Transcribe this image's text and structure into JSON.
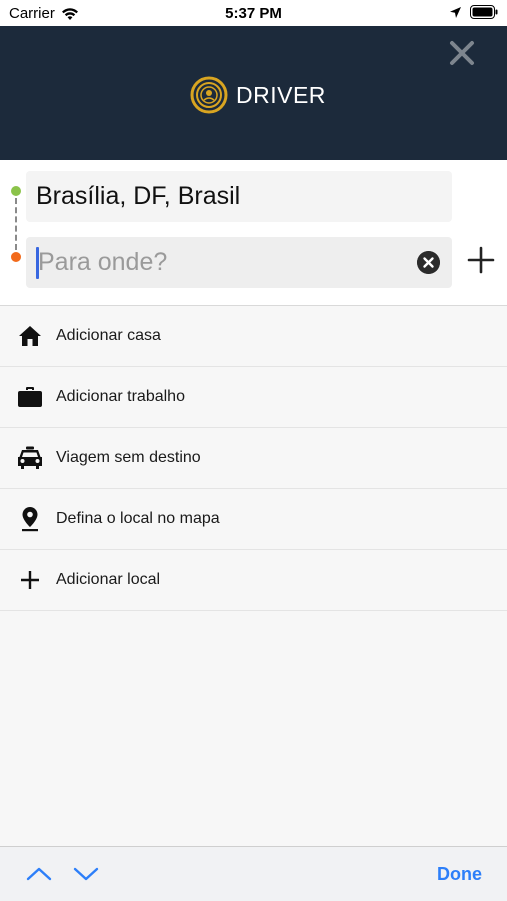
{
  "status_bar": {
    "carrier": "Carrier",
    "time": "5:37 PM",
    "icons": [
      "wifi-icon",
      "location-arrow-icon",
      "battery-icon"
    ]
  },
  "header": {
    "logo_text": "DRIVER",
    "close_icon": "close-icon",
    "background_color": "#1c2a3b",
    "accent_color": "#d9a521"
  },
  "route": {
    "origin_value": "Brasília, DF, Brasil",
    "destination_placeholder": "Para onde?",
    "destination_value": "",
    "origin_dot_color": "#8bc34a",
    "destination_dot_color": "#f26a1b"
  },
  "suggestions": [
    {
      "label": "Adicionar casa",
      "icon": "home-icon"
    },
    {
      "label": "Adicionar trabalho",
      "icon": "briefcase-icon"
    },
    {
      "label": "Viagem sem destino",
      "icon": "taxi-icon"
    },
    {
      "label": "Defina o local no mapa",
      "icon": "map-pin-icon"
    },
    {
      "label": "Adicionar local",
      "icon": "plus-icon"
    }
  ],
  "toolbar": {
    "done_label": "Done",
    "done_color": "#2d7ff9"
  }
}
